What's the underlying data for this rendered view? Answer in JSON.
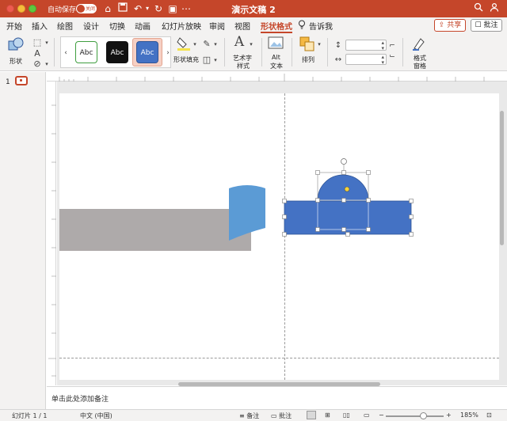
{
  "titlebar": {
    "autosave_label": "自动保存",
    "autosave_state": "关闭",
    "doc_title": "演示文稿 2",
    "accent": "#c5462a"
  },
  "menu": {
    "tabs": [
      {
        "label": "开始"
      },
      {
        "label": "插入"
      },
      {
        "label": "绘图"
      },
      {
        "label": "设计"
      },
      {
        "label": "切换"
      },
      {
        "label": "动画"
      },
      {
        "label": "幻灯片放映"
      },
      {
        "label": "审阅"
      },
      {
        "label": "视图"
      },
      {
        "label": "形状格式"
      }
    ],
    "tell_me": "告诉我",
    "share": "共享",
    "comments": "批注"
  },
  "ribbon": {
    "shape_label": "形状",
    "style_swatches": [
      "Abc",
      "Abc",
      "Abc"
    ],
    "shape_fill": "形状填充",
    "wordart_line1": "艺术字",
    "wordart_line2": "样式",
    "alt_line1": "Alt",
    "alt_line2": "文本",
    "arrange": "排列",
    "format_line1": "格式",
    "format_line2": "窗格"
  },
  "slides": {
    "current_number": "1"
  },
  "notes": {
    "placeholder": "单击此处添加备注"
  },
  "status": {
    "slide_info": "幻灯片 1 / 1",
    "language": "中文 (中国)",
    "notes_btn": "备注",
    "comments_btn": "批注",
    "zoom": "185%"
  },
  "shapes": {
    "gray_fill": "#aeaaaa",
    "blue_light": "#5b9bd5",
    "blue": "#4472c4",
    "blue_border": "#2f5597"
  }
}
